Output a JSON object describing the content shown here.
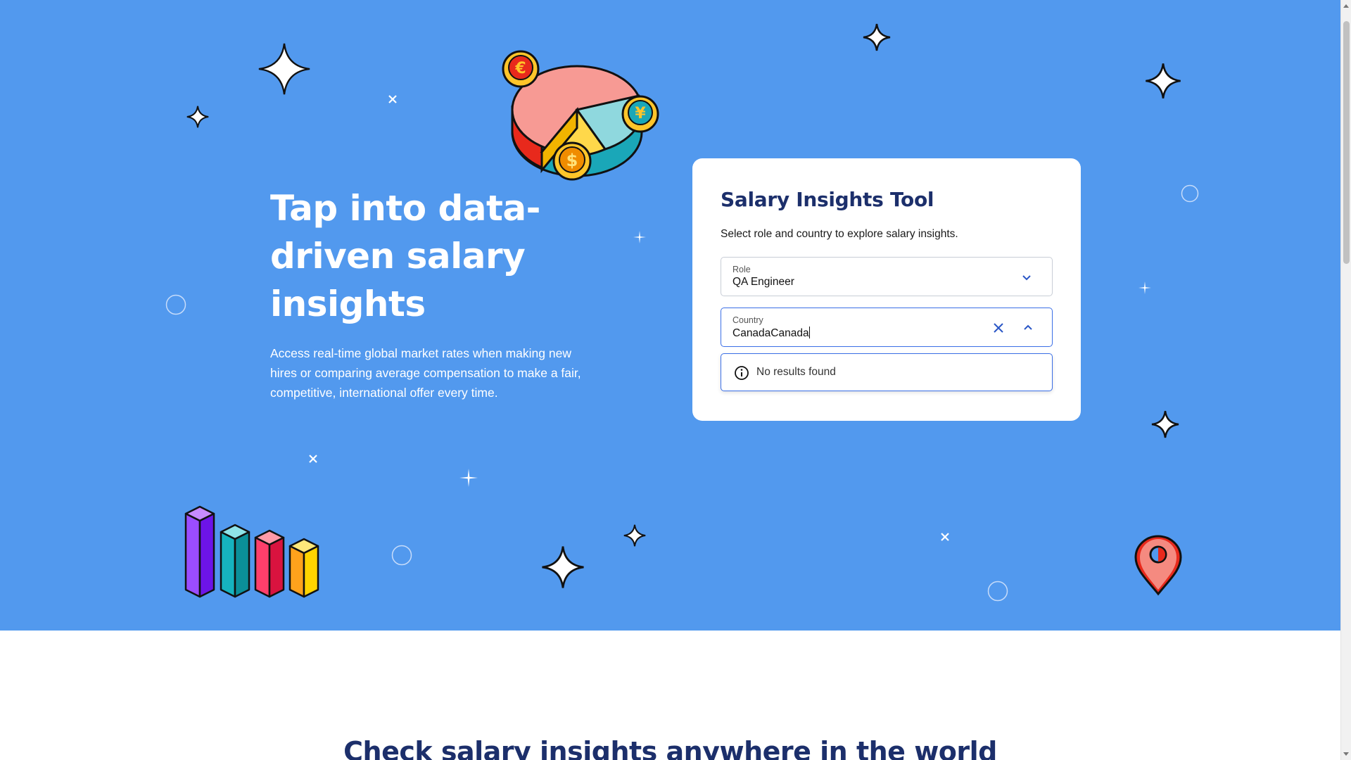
{
  "hero": {
    "title": "Tap into data-driven salary insights",
    "subtitle": "Access real-time global market rates when making new hires or comparing average compensation to make a fair, competitive, international offer every time."
  },
  "tool": {
    "title": "Salary Insights Tool",
    "description": "Select role and country to explore salary insights.",
    "role": {
      "label": "Role",
      "value": "QA Engineer"
    },
    "country": {
      "label": "Country",
      "value": "CanadaCanada"
    },
    "dropdown": {
      "message": "No results found"
    }
  },
  "section": {
    "title": "Check salary insights anywhere in the world"
  },
  "icons": {
    "role_chevron": "chevron-down-icon",
    "country_clear": "close-icon",
    "country_chevron": "chevron-up-icon",
    "dropdown_info": "info-icon",
    "coin_euro": "€",
    "coin_yen": "¥",
    "coin_dollar": "$"
  },
  "colors": {
    "hero_bg": "#5299ee",
    "heading": "#1c2f6b",
    "accent": "#3a6ee6"
  }
}
